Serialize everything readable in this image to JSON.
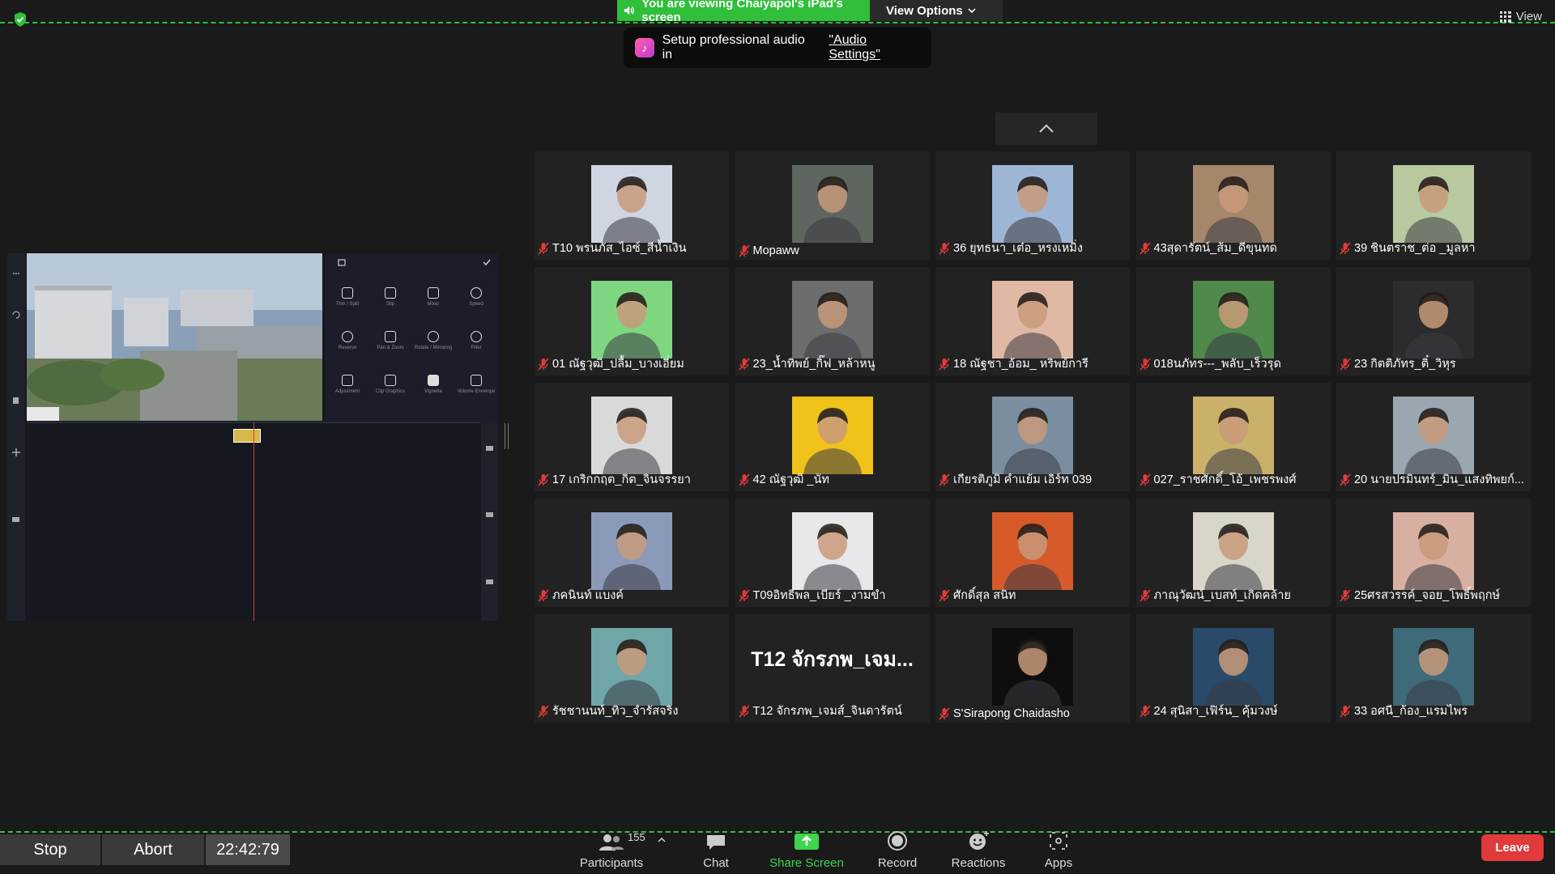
{
  "banner": {
    "viewing_text": "You are viewing Chaiyapol's iPad's screen",
    "view_options_label": "View Options"
  },
  "audio_popup": {
    "text": "Setup professional audio in",
    "link": "\"Audio Settings\""
  },
  "view_button_label": "View",
  "participants": [
    {
      "name": "T10 พรนภัส_ไอซ์_สีน้ำเงิน",
      "photo_color": "#cfd6e2"
    },
    {
      "name": "Mopaww",
      "photo_color": "#5f6660"
    },
    {
      "name": "36 ยุทธนา_เต๋อ_หรงเหมิ่ง",
      "photo_color": "#9eb6d6"
    },
    {
      "name": "43สุดารัตน์_ส้ม_ดีขุนทด",
      "photo_color": "#a5876a"
    },
    {
      "name": "39 ชินตราช_ต่อ _มูลหา",
      "photo_color": "#b8c9a0"
    },
    {
      "name": "01 ณัฐวุฒิ_ปลื้ม_บางเอี่ยม",
      "photo_color": "#7fd680"
    },
    {
      "name": "23_น้ำทิพย์_กิ๊ฟ_หล้าหนู",
      "photo_color": "#6d6d6d"
    },
    {
      "name": "18 ณัฐชา_อ้อม_ หริพย์การี",
      "photo_color": "#e0b8a4"
    },
    {
      "name": "018นภัทร---_พลับ_เร็วรุด",
      "photo_color": "#4f8a4a"
    },
    {
      "name": "23 กิตติภัทร_ติ๋_วิหุร",
      "photo_color": "#2c2c2c"
    },
    {
      "name": "17 เกริกกฤต_กิต_จินจรรยา",
      "photo_color": "#d9d9d9"
    },
    {
      "name": "42 ณัฐวุฒิ _นัท",
      "photo_color": "#f0c21a"
    },
    {
      "name": "เกียรติภูมิ คำแย้ม เอิร์ท 039",
      "photo_color": "#7a8ea0"
    },
    {
      "name": "027_ราชศักดิ์_โอ้_เพชรพงศ์",
      "photo_color": "#c9b16a"
    },
    {
      "name": "20 นายปรมินทร์_มิน_แสงทิพยก์...",
      "photo_color": "#9aa6b0"
    },
    {
      "name": "ภคนินท์ แบงค์",
      "photo_color": "#8a9ab8"
    },
    {
      "name": "T09อิทธิพล_เบียร์ _งามขำ",
      "photo_color": "#e8e8ea"
    },
    {
      "name": "ศักดิ์สุล สนิท",
      "photo_color": "#d65a2a"
    },
    {
      "name": "ภาณุวัฒน์_เบสท์_เกิดคล้าย",
      "photo_color": "#d8d6c8"
    },
    {
      "name": "25ศรสวรรค์_จอย_โพธิ์พฤกษ์",
      "photo_color": "#d8b0a2"
    },
    {
      "name": "รัชชานนท์_ทิว_จำรัสจริง",
      "photo_color": "#6fa6a8"
    },
    {
      "name": "T12 จักรภพ_เจมส์_จินดารัตน์",
      "photo_color": "",
      "text_avatar": "T12 จักรภพ_เจม..."
    },
    {
      "name": "S'Sirapong Chaidasho",
      "photo_color": "#0e0e0e"
    },
    {
      "name": "24 สุนิสา_เฟิร์น_ คุ้มวงษ์",
      "photo_color": "#2a4a6a"
    },
    {
      "name": "33 อศนี_ก้อง_แรมไพร",
      "photo_color": "#3f6a7a"
    }
  ],
  "recording": {
    "stop_label": "Stop",
    "abort_label": "Abort",
    "elapsed": "22:42:79"
  },
  "toolbar": {
    "participants_label": "Participants",
    "participants_count": "155",
    "chat_label": "Chat",
    "share_label": "Share Screen",
    "record_label": "Record",
    "reactions_label": "Reactions",
    "apps_label": "Apps",
    "leave_label": "Leave"
  },
  "colors": {
    "green_accent": "#2fbf3a",
    "leave_red": "#e03a3a",
    "background": "#1a1a1a",
    "tile": "#222222"
  }
}
